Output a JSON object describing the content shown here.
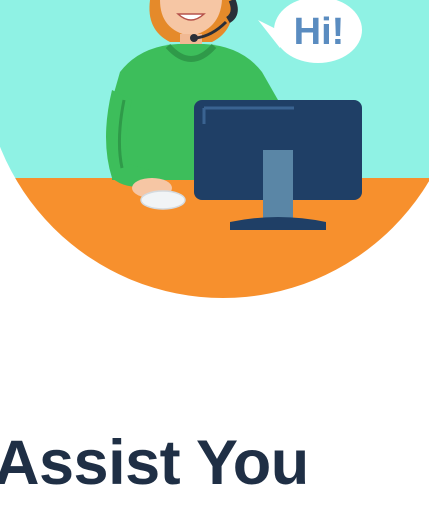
{
  "illustration": {
    "speech_text": "Hi!",
    "icon": "support-agent-illustration",
    "colors": {
      "sky": "#8ff2e4",
      "desk": "#f7902d",
      "shirt": "#3dbe5b",
      "monitor": "#1f3f66",
      "bubble": "#ffffff",
      "bubble_text": "#5a8cc0"
    }
  },
  "heading": {
    "text": "Assist You",
    "color": "#1f2f45"
  }
}
